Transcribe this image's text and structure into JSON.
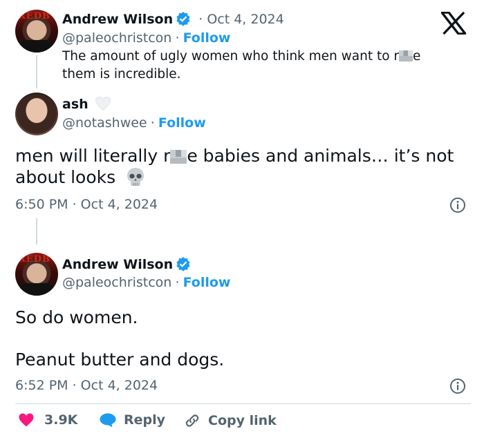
{
  "tweet1": {
    "name": "Andrew Wilson",
    "date_sep": "· Oct 4, 2024",
    "handle": "@paleochristcon",
    "dot": "·",
    "follow": "Follow",
    "text_line1_a": "The amount of ugly women who think men want to r",
    "text_line1_b": "e",
    "text_line2": "them is incredible."
  },
  "tweet2": {
    "name": "ash",
    "handle": "@notashwee",
    "dot": "·",
    "follow": "Follow",
    "text_a": "men will literally r",
    "text_b": "e babies and animals… it’s not",
    "text_c": "about looks",
    "timestamp": "6:50 PM · Oct 4, 2024"
  },
  "tweet3": {
    "name": "Andrew Wilson",
    "handle": "@paleochristcon",
    "dot": "·",
    "follow": "Follow",
    "text_line1": "So do women.",
    "text_line2": "Peanut butter and dogs.",
    "timestamp": "6:52 PM · Oct 4, 2024"
  },
  "actions": {
    "likes": "3.9K",
    "reply": "Reply",
    "copy_link": "Copy link"
  },
  "avatar_text": "REDB",
  "colors": {
    "link_blue": "#1d9bf0",
    "muted": "#536471",
    "heart": "#f91880",
    "divider": "#cfd9de"
  },
  "icons": [
    "x-logo-icon",
    "verified-badge-icon",
    "heart-outline-icon",
    "info-icon",
    "heart-icon",
    "reply-bubble-icon",
    "link-icon",
    "skull-icon"
  ]
}
